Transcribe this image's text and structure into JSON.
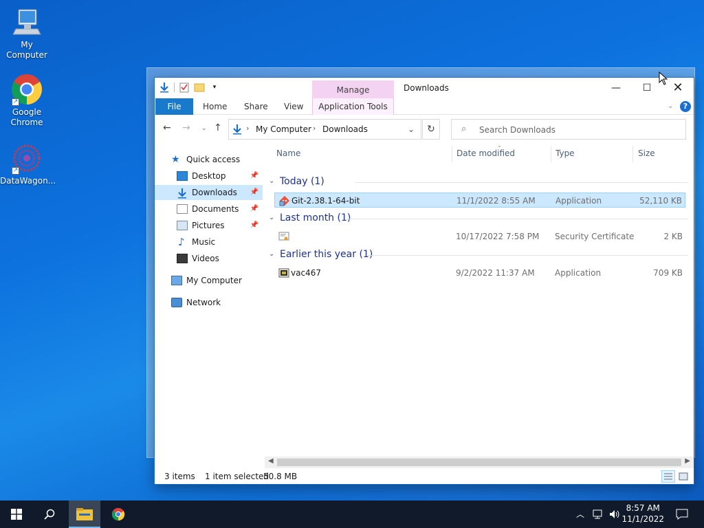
{
  "desktop": {
    "icons": [
      {
        "label": "My Computer",
        "icon": "computer-icon"
      },
      {
        "label": "Google Chrome",
        "icon": "chrome-icon"
      },
      {
        "label": "DataWagon...",
        "icon": "datawagon-icon"
      }
    ]
  },
  "window": {
    "title": "Downloads",
    "context_tab": "Manage",
    "ribbon_tabs": [
      "File",
      "Home",
      "Share",
      "View",
      "Application Tools"
    ],
    "address": {
      "crumbs": [
        "My Computer",
        "Downloads"
      ]
    },
    "search_placeholder": "Search Downloads",
    "nav": {
      "quick_access": "Quick access",
      "items": [
        {
          "label": "Desktop",
          "pinned": true
        },
        {
          "label": "Downloads",
          "pinned": true,
          "selected": true
        },
        {
          "label": "Documents",
          "pinned": true
        },
        {
          "label": "Pictures",
          "pinned": true
        },
        {
          "label": "Music",
          "pinned": false
        },
        {
          "label": "Videos",
          "pinned": false
        }
      ],
      "my_computer": "My Computer",
      "network": "Network"
    },
    "columns": [
      "Name",
      "Date modified",
      "Type",
      "Size"
    ],
    "groups": [
      {
        "label": "Today (1)",
        "files": [
          {
            "name": "Git-2.38.1-64-bit",
            "date": "11/1/2022 8:55 AM",
            "type": "Application",
            "size": "52,110 KB",
            "selected": true
          }
        ]
      },
      {
        "label": "Last month (1)",
        "files": [
          {
            "name": "",
            "date": "10/17/2022 7:58 PM",
            "type": "Security Certificate",
            "size": "2 KB",
            "selected": false
          }
        ]
      },
      {
        "label": "Earlier this year (1)",
        "files": [
          {
            "name": "vac467",
            "date": "9/2/2022 11:37 AM",
            "type": "Application",
            "size": "709 KB",
            "selected": false
          }
        ]
      }
    ],
    "status": {
      "items": "3 items",
      "selected": "1 item selected",
      "size": "50.8 MB"
    }
  },
  "taskbar": {
    "time": "8:57 AM",
    "date": "11/1/2022"
  }
}
